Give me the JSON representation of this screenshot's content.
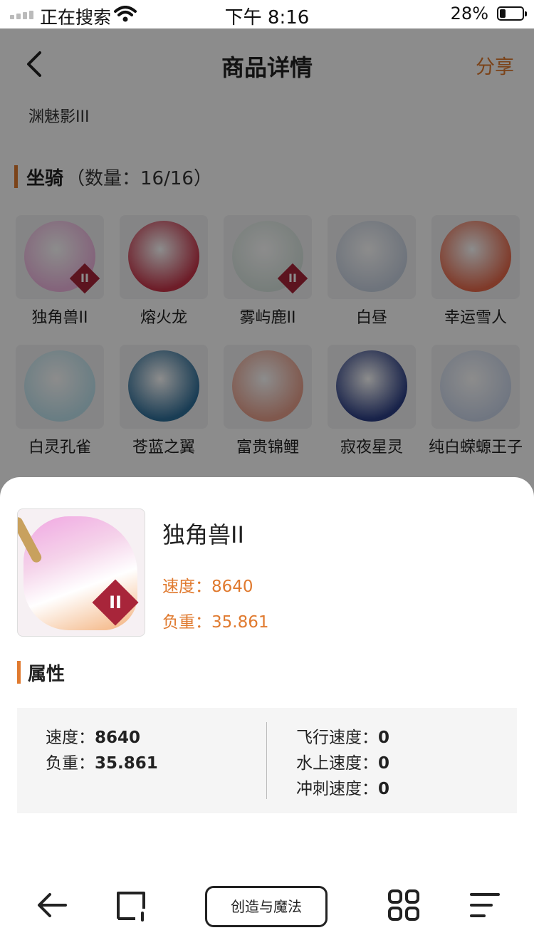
{
  "status_bar": {
    "carrier": "正在搜索",
    "time": "下午 8:16",
    "battery_percent": "28%",
    "battery_level": 0.28
  },
  "nav": {
    "title": "商品详情",
    "share_label": "分享"
  },
  "item_title": "渊魅影III",
  "mounts_section": {
    "title": "坐骑",
    "count_text": "（数量：16/16）",
    "items": [
      {
        "name": "独角兽II",
        "badge": "II",
        "color": "#f0b6e0"
      },
      {
        "name": "熔火龙",
        "badge": "",
        "color": "#c8354a"
      },
      {
        "name": "雾屿鹿II",
        "badge": "II",
        "color": "#d9e6e0"
      },
      {
        "name": "白昼",
        "badge": "",
        "color": "#c9d3e2"
      },
      {
        "name": "幸运雪人",
        "badge": "",
        "color": "#e86a4c"
      },
      {
        "name": "白灵孔雀",
        "badge": "",
        "color": "#bfe4ef"
      },
      {
        "name": "苍蓝之翼",
        "badge": "",
        "color": "#2f6f9a"
      },
      {
        "name": "富贵锦鲤",
        "badge": "",
        "color": "#e9a08c"
      },
      {
        "name": "寂夜星灵",
        "badge": "",
        "color": "#2c3f86"
      },
      {
        "name": "纯白蝾螈王子",
        "badge": "",
        "color": "#cdd8ec"
      }
    ]
  },
  "detail": {
    "name": "独角兽II",
    "badge": "II",
    "speed_text": "速度：8640",
    "load_text": "负重：35.861"
  },
  "attributes": {
    "title": "属性",
    "left": [
      {
        "label": "速度：",
        "value": "8640"
      },
      {
        "label": "负重：",
        "value": "35.861"
      }
    ],
    "right": [
      {
        "label": "飞行速度：",
        "value": "0"
      },
      {
        "label": "水上速度：",
        "value": "0"
      },
      {
        "label": "冲刺速度：",
        "value": "0"
      }
    ]
  },
  "toolbar": {
    "center_label": "创造与魔法",
    "icons": [
      "back-arrow-icon",
      "window-icon",
      "grid-icon",
      "menu-icon"
    ]
  }
}
